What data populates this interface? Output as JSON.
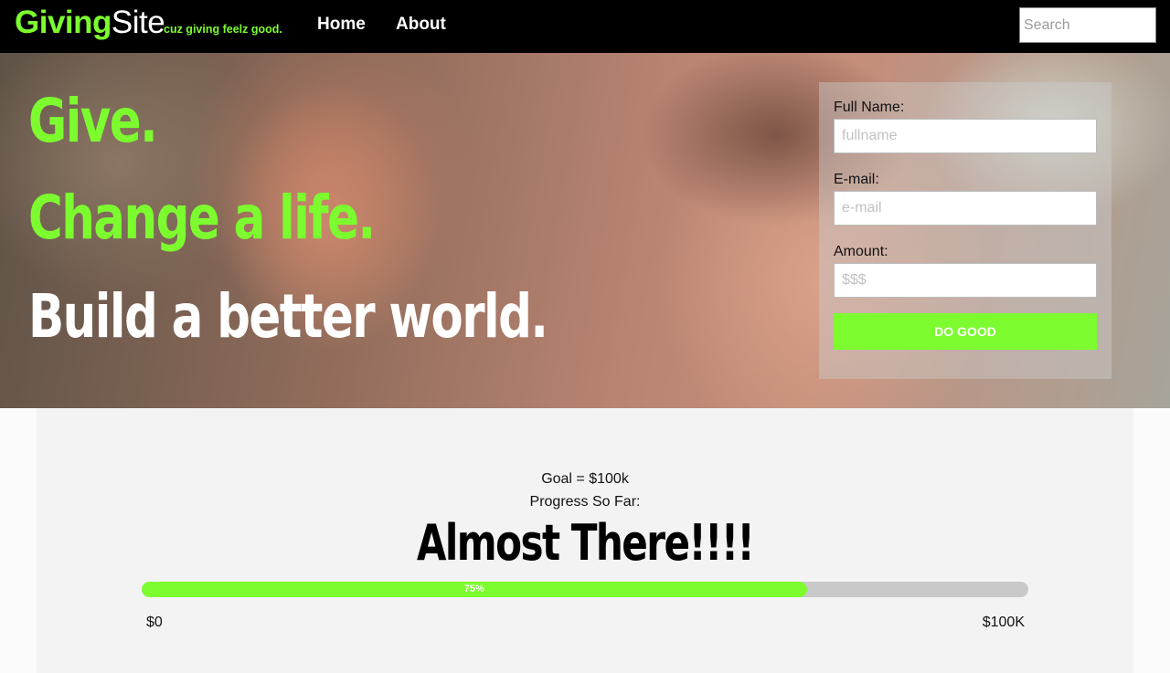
{
  "nav": {
    "logo_part1": "Giving",
    "logo_part2": "Site",
    "tagline": "cuz giving feelz good.",
    "links": [
      "Home",
      "About"
    ],
    "search_placeholder": "Search"
  },
  "hero": {
    "line1": "Give.",
    "line2": "Change a life.",
    "line3": "Build a better world."
  },
  "form": {
    "name_label": "Full Name:",
    "name_placeholder": "fullname",
    "email_label": "E-mail:",
    "email_placeholder": "e-mail",
    "amount_label": "Amount:",
    "amount_placeholder": "$$$",
    "submit_label": "DO GOOD"
  },
  "progress": {
    "goal_text": "Goal = $100k",
    "so_far_text": "Progress So Far:",
    "headline": "Almost There!!!!",
    "percent": 75,
    "percent_label": "75%",
    "min_label": "$0",
    "max_label": "$100K"
  },
  "colors": {
    "accent": "#7cfc2f",
    "nav_bg": "#000000",
    "bar_track": "#c9c9c9",
    "panel_bg": "#f3f3f3"
  }
}
